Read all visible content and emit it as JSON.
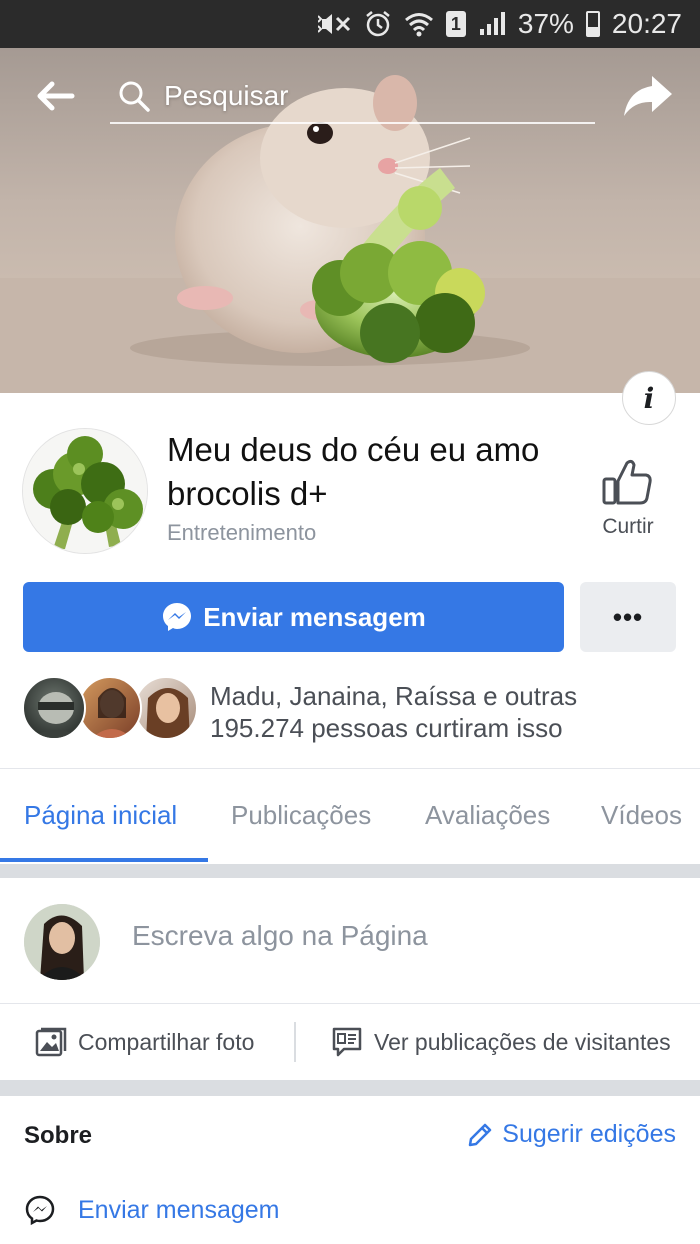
{
  "status_bar": {
    "battery": "37%",
    "time": "20:27",
    "sim": "1"
  },
  "search": {
    "placeholder": "Pesquisar"
  },
  "page": {
    "title": "Meu deus do céu eu amo brocolis d+",
    "category": "Entretenimento",
    "like_label": "Curtir"
  },
  "actions": {
    "send_message": "Enviar mensagem",
    "more": "•••"
  },
  "likes": {
    "line1": "Madu, Janaina, Raíssa e outras",
    "line2": "195.274 pessoas curtiram isso"
  },
  "tabs": [
    {
      "label": "Página inicial",
      "active": true
    },
    {
      "label": "Publicações"
    },
    {
      "label": "Avaliações"
    },
    {
      "label": "Vídeos"
    }
  ],
  "composer": {
    "placeholder": "Escreva algo na Página",
    "share_photo": "Compartilhar foto",
    "visitor_posts": "Ver publicações de visitantes"
  },
  "about": {
    "title": "Sobre",
    "suggest_edits": "Sugerir edições",
    "send_message": "Enviar mensagem"
  },
  "colors": {
    "accent": "#3578e5",
    "status_bar": "#2b2b2b"
  }
}
